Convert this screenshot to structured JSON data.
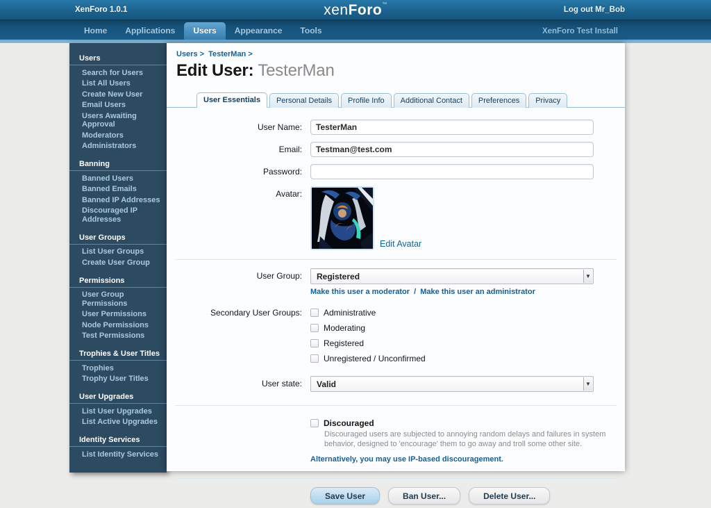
{
  "colors": {
    "header_blue": "#1d6695",
    "nav_blue": "#16537c",
    "active_tab_blue": "#4a91c1",
    "sidebar_bg": "#2c4a60",
    "link_blue": "#176093",
    "content_bg": "#fcfdff",
    "primary_button": "#a9d0e9"
  },
  "header": {
    "version": "XenForo 1.0.1",
    "logo_xen": "xen",
    "logo_foro": "Foro",
    "logo_tm": "™",
    "logout": "Log out Mr_Bob"
  },
  "nav": {
    "tabs": [
      {
        "label": "Home"
      },
      {
        "label": "Applications"
      },
      {
        "label": "Users"
      },
      {
        "label": "Appearance"
      },
      {
        "label": "Tools"
      }
    ],
    "right_label": "XenForo Test Install"
  },
  "sidebar": {
    "sections": [
      {
        "title": "Users",
        "links": [
          "Search for Users",
          "List All Users",
          "Create New User",
          "Email Users",
          "Users Awaiting Approval",
          "Moderators",
          "Administrators"
        ]
      },
      {
        "title": "Banning",
        "links": [
          "Banned Users",
          "Banned Emails",
          "Banned IP Addresses",
          "Discouraged IP Addresses"
        ]
      },
      {
        "title": "User Groups",
        "links": [
          "List User Groups",
          "Create User Group"
        ]
      },
      {
        "title": "Permissions",
        "links": [
          "User Group Permissions",
          "User Permissions",
          "Node Permissions",
          "Test Permissions"
        ]
      },
      {
        "title": "Trophies & User Titles",
        "links": [
          "Trophies",
          "Trophy User Titles"
        ]
      },
      {
        "title": "User Upgrades",
        "links": [
          "List User Upgrades",
          "List Active Upgrades"
        ]
      },
      {
        "title": "Identity Services",
        "links": [
          "List Identity Services"
        ]
      }
    ]
  },
  "main": {
    "breadcrumb": {
      "items": [
        "Users",
        "TesterMan"
      ],
      "separator": ">"
    },
    "title_prefix": "Edit User:",
    "title_name": "TesterMan",
    "tabs": [
      {
        "label": "User Essentials"
      },
      {
        "label": "Personal Details"
      },
      {
        "label": "Profile Info"
      },
      {
        "label": "Additional Contact"
      },
      {
        "label": "Preferences"
      },
      {
        "label": "Privacy"
      }
    ],
    "form": {
      "user_name": {
        "label": "User Name:",
        "value": "TesterMan"
      },
      "email": {
        "label": "Email:",
        "value": "Testman@test.com"
      },
      "password": {
        "label": "Password:",
        "value": ""
      },
      "avatar": {
        "label": "Avatar:",
        "edit_link": "Edit Avatar"
      },
      "user_group": {
        "label": "User Group:",
        "value": "Registered",
        "link_moderator": "Make this user a moderator",
        "link_administrator": "Make this user an administrator",
        "links_separator": "/"
      },
      "secondary_groups": {
        "label": "Secondary User Groups:",
        "options": [
          "Administrative",
          "Moderating",
          "Registered",
          "Unregistered / Unconfirmed"
        ]
      },
      "user_state": {
        "label": "User state:",
        "value": "Valid"
      },
      "discouraged": {
        "label": "Discouraged",
        "description": "Discouraged users are subjected to annoying random delays and failures in system behavior, designed to 'encourage' them to go away and troll some other site.",
        "alt_link": "Alternatively, you may use IP-based discouragement."
      },
      "buttons": {
        "save": "Save User",
        "ban": "Ban User...",
        "delete": "Delete User..."
      }
    }
  }
}
